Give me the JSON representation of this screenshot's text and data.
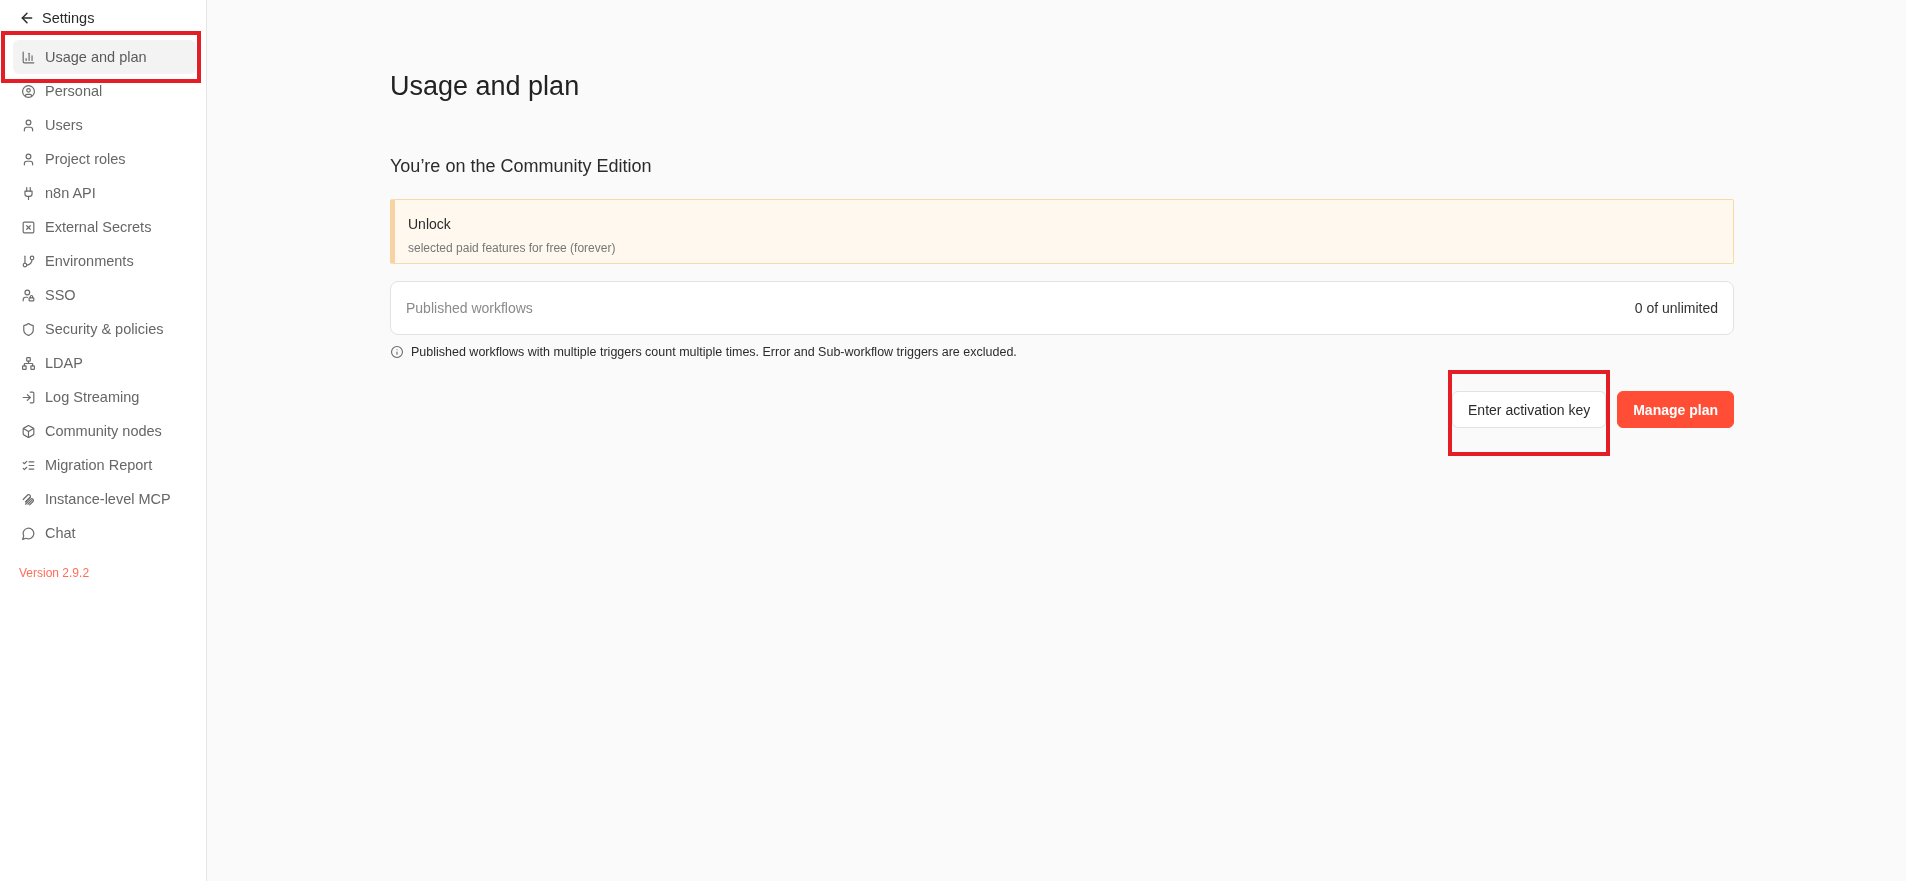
{
  "sidebar": {
    "back": {
      "label": "Settings"
    },
    "items": [
      {
        "label": "Usage and plan",
        "selected": true,
        "highlighted": true
      },
      {
        "label": "Personal",
        "selected": false,
        "highlighted": false
      },
      {
        "label": "Users",
        "selected": false,
        "highlighted": false
      },
      {
        "label": "Project roles",
        "selected": false,
        "highlighted": false
      },
      {
        "label": "n8n API",
        "selected": false,
        "highlighted": false
      },
      {
        "label": "External Secrets",
        "selected": false,
        "highlighted": false
      },
      {
        "label": "Environments",
        "selected": false,
        "highlighted": false
      },
      {
        "label": "SSO",
        "selected": false,
        "highlighted": false
      },
      {
        "label": "Security & policies",
        "selected": false,
        "highlighted": false
      },
      {
        "label": "LDAP",
        "selected": false,
        "highlighted": false
      },
      {
        "label": "Log Streaming",
        "selected": false,
        "highlighted": false
      },
      {
        "label": "Community nodes",
        "selected": false,
        "highlighted": false
      },
      {
        "label": "Migration Report",
        "selected": false,
        "highlighted": false
      },
      {
        "label": "Instance-level MCP",
        "selected": false,
        "highlighted": false
      },
      {
        "label": "Chat",
        "selected": false,
        "highlighted": false
      }
    ],
    "version": "Version 2.9.2"
  },
  "page": {
    "title": "Usage and plan",
    "plan_heading": "You’re on the Community Edition",
    "callout": {
      "title": "Unlock",
      "text": "selected paid features for free (forever)"
    },
    "usage": {
      "label": "Published workflows",
      "value": "0 of unlimited"
    },
    "note": "Published workflows with multiple triggers count multiple times. Error and Sub-workflow triggers are excluded.",
    "buttons": [
      {
        "label": "Enter activation key",
        "kind": "secondary",
        "highlighted": true
      },
      {
        "label": "Manage plan",
        "kind": "primary",
        "highlighted": false
      }
    ]
  }
}
